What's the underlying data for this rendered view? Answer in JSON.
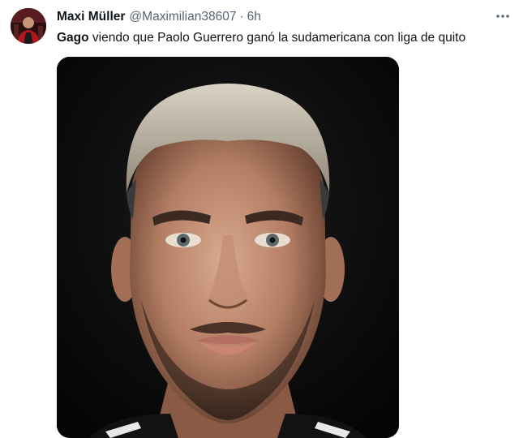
{
  "tweet": {
    "display_name": "Maxi Müller",
    "handle": "@Maximilian38607",
    "separator": "·",
    "time": "6h",
    "text_bold": "Gago",
    "text_rest": " viendo que Paolo Guerrero ganó la sudamericana con liga de quito",
    "more_icon": "more-horizontal-icon",
    "media_description": "photo"
  },
  "colors": {
    "primary_text": "#0f1419",
    "secondary_text": "#536471",
    "media_background": "#0b0b0b"
  }
}
